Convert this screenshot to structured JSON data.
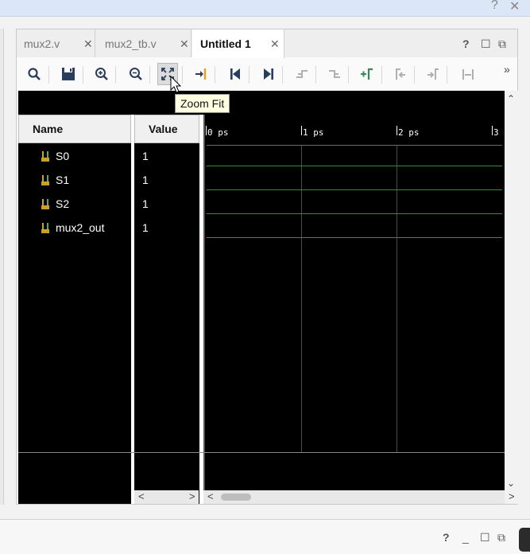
{
  "top_controls": {
    "help": "?",
    "close": "✕"
  },
  "tabs": [
    {
      "label": "mux2.v",
      "close": "✕",
      "active": false
    },
    {
      "label": "mux2_tb.v",
      "close": "✕",
      "active": false
    },
    {
      "label": "Untitled 1",
      "close": "✕",
      "active": true
    }
  ],
  "panel_controls": {
    "help": "?",
    "maximize": "☐",
    "float": "⧉"
  },
  "toolbar": {
    "buttons": [
      "search-icon",
      "save-icon",
      "zoom-in-icon",
      "zoom-out-icon",
      "zoom-fit-icon",
      "go-to-cursor-icon",
      "go-to-time-zero-icon",
      "go-to-last-time-icon",
      "previous-transition-icon",
      "next-transition-icon",
      "add-marker-icon",
      "previous-marker-icon",
      "next-marker-icon",
      "swap-cursors-icon"
    ],
    "overflow": "»"
  },
  "tooltip": "Zoom Fit",
  "columns": {
    "name": "Name",
    "value": "Value"
  },
  "signals": [
    {
      "name": "S0",
      "value": "1",
      "type": "bit"
    },
    {
      "name": "S1",
      "value": "1",
      "type": "bit"
    },
    {
      "name": "S2",
      "value": "1",
      "type": "bit"
    },
    {
      "name": "mux2_out",
      "value": "1",
      "type": "bit"
    }
  ],
  "timeline": {
    "ticks": [
      "0 ps",
      "1 ps",
      "2 ps",
      "3"
    ]
  },
  "scroll": {
    "left": "<",
    "right": ">",
    "up": "⌃",
    "down": "⌄"
  },
  "colors": {
    "waveform_bg": "#000000",
    "signal_line": "#3a8a3a",
    "signal_text": "#ffffff"
  },
  "bottom_controls": {
    "help": "?",
    "minimize": "_",
    "maximize": "☐",
    "float": "⧉"
  }
}
